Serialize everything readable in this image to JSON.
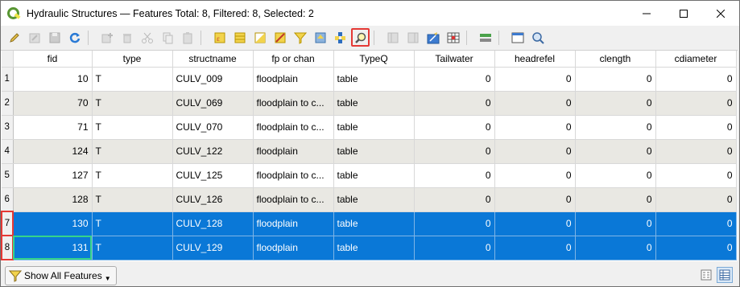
{
  "window": {
    "title": "Hydraulic Structures — Features Total: 8, Filtered: 8, Selected: 2"
  },
  "toolbar": {
    "icons": [
      "pencil-icon",
      "multi-edit-icon",
      "save-icon",
      "reload-icon",
      "add-feature-icon",
      "delete-icon",
      "cut-icon",
      "copy-icon",
      "paste-icon",
      "select-expression-icon",
      "select-all-icon",
      "invert-selection-icon",
      "deselect-icon",
      "filter-selected-icon",
      "move-selection-top-icon",
      "pan-to-selected-icon",
      "zoom-to-selected-icon",
      "new-field-icon",
      "delete-field-icon",
      "field-calculator-icon",
      "conditional-format-icon",
      "actions-icon",
      "dock-icon",
      "organize-columns-icon"
    ]
  },
  "table": {
    "columns": [
      "fid",
      "type",
      "structname",
      "fp or chan",
      "TypeQ",
      "Tailwater",
      "headrefel",
      "clength",
      "cdiameter"
    ],
    "rows": [
      {
        "rownum": "1",
        "fid": "10",
        "type": "T",
        "structname": "CULV_009",
        "fp": "floodplain",
        "typeq": "table",
        "tailwater": "0",
        "headrefel": "0",
        "clength": "0",
        "cdiameter": "0"
      },
      {
        "rownum": "2",
        "fid": "70",
        "type": "T",
        "structname": "CULV_069",
        "fp": "floodplain to c...",
        "typeq": "table",
        "tailwater": "0",
        "headrefel": "0",
        "clength": "0",
        "cdiameter": "0"
      },
      {
        "rownum": "3",
        "fid": "71",
        "type": "T",
        "structname": "CULV_070",
        "fp": "floodplain to c...",
        "typeq": "table",
        "tailwater": "0",
        "headrefel": "0",
        "clength": "0",
        "cdiameter": "0"
      },
      {
        "rownum": "4",
        "fid": "124",
        "type": "T",
        "structname": "CULV_122",
        "fp": "floodplain",
        "typeq": "table",
        "tailwater": "0",
        "headrefel": "0",
        "clength": "0",
        "cdiameter": "0"
      },
      {
        "rownum": "5",
        "fid": "127",
        "type": "T",
        "structname": "CULV_125",
        "fp": "floodplain to c...",
        "typeq": "table",
        "tailwater": "0",
        "headrefel": "0",
        "clength": "0",
        "cdiameter": "0"
      },
      {
        "rownum": "6",
        "fid": "128",
        "type": "T",
        "structname": "CULV_126",
        "fp": "floodplain to c...",
        "typeq": "table",
        "tailwater": "0",
        "headrefel": "0",
        "clength": "0",
        "cdiameter": "0"
      },
      {
        "rownum": "7",
        "fid": "130",
        "type": "T",
        "structname": "CULV_128",
        "fp": "floodplain",
        "typeq": "table",
        "tailwater": "0",
        "headrefel": "0",
        "clength": "0",
        "cdiameter": "0"
      },
      {
        "rownum": "8",
        "fid": "131",
        "type": "T",
        "structname": "CULV_129",
        "fp": "floodplain",
        "typeq": "table",
        "tailwater": "0",
        "headrefel": "0",
        "clength": "0",
        "cdiameter": "0"
      }
    ]
  },
  "bottom": {
    "filter_label": "Show All Features"
  },
  "colors": {
    "selection": "#0a78d7",
    "highlight_border": "#e53935",
    "focus_border": "#35d48a",
    "alt_row": "#e9e8e3"
  }
}
